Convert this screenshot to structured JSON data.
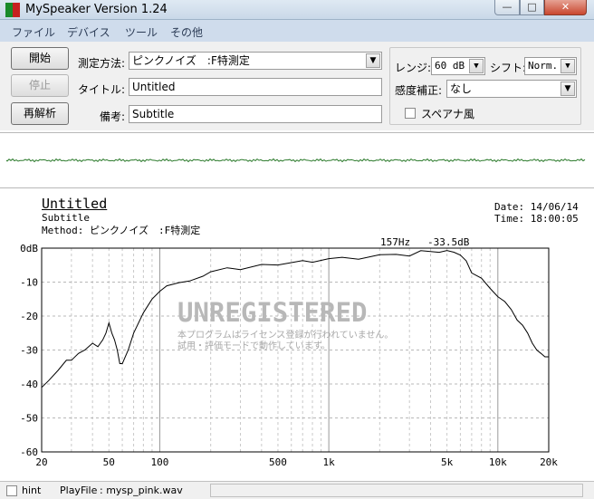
{
  "window": {
    "title": "MySpeaker Version 1.24",
    "min_glyph": "—",
    "max_glyph": "□",
    "close_glyph": "✕"
  },
  "menu": [
    "ファイル",
    "デバイス",
    "ツール",
    "その他"
  ],
  "buttons": {
    "start": "開始",
    "stop": "停止",
    "reanalyze": "再解析"
  },
  "fields": {
    "method_label": "測定方法:",
    "method_value": "ピンクノイズ　:F特測定",
    "title_label": "タイトル:",
    "title_value": "Untitled",
    "note_label": "備考:",
    "note_value": "Subtitle"
  },
  "right_panel": {
    "range_label": "レンジ:",
    "range_value": "60 dB",
    "shift_label": "シフト:",
    "shift_value": "Norm.",
    "sensitivity_label": "感度補正:",
    "sensitivity_value": "なし",
    "spectrum_label": "スペアナ風",
    "spectrum_checked": false
  },
  "graph_header": {
    "title": "Untitled",
    "subtitle": "Subtitle",
    "method": "Method:  ピンクノイズ　:F特測定",
    "date": "Date: 14/06/14",
    "time": "Time: 18:00:05",
    "peak_freq": "157Hz",
    "peak_level": "-33.5dB"
  },
  "watermark": {
    "title": "UNREGISTERED",
    "line1": "本プログラムはライセンス登録が行われていません。",
    "line2": "試用・評価モードで動作しています。"
  },
  "chart_data": {
    "type": "line",
    "xscale": "log",
    "xlim": [
      20,
      20000
    ],
    "ylim": [
      -60,
      0
    ],
    "y_ticks": [
      "0dB",
      "-10",
      "-20",
      "-30",
      "-40",
      "-50",
      "-60"
    ],
    "x_ticks": [
      "20",
      "50",
      "100",
      "500",
      "1k",
      "5k",
      "10k",
      "20k"
    ],
    "grid": true,
    "series": [
      {
        "x": [
          20,
          22,
          25,
          28,
          30,
          33,
          36,
          40,
          43,
          46,
          48,
          50,
          52,
          54,
          56,
          58,
          60,
          65,
          70,
          80,
          90,
          100,
          110,
          130,
          150,
          180,
          200,
          250,
          300,
          400,
          500,
          600,
          700,
          800,
          1000,
          1200,
          1500,
          2000,
          2500,
          3000,
          3500,
          4000,
          4500,
          5000,
          5500,
          6000,
          6500,
          7000,
          8000,
          9000,
          10000,
          11000,
          12000,
          13000,
          14000,
          15000,
          16000,
          17000,
          18000,
          19000,
          20000
        ],
        "values": [
          -41,
          -39,
          -36,
          -33,
          -33,
          -31,
          -30,
          -28,
          -29,
          -27,
          -25,
          -22,
          -25,
          -27,
          -30,
          -34,
          -34,
          -30,
          -25,
          -19,
          -15,
          -13,
          -11,
          -10,
          -10,
          -8,
          -7,
          -6,
          -6,
          -5,
          -5,
          -4,
          -4,
          -4,
          -3,
          -3,
          -3,
          -2,
          -2,
          -2,
          -1,
          -1,
          -1,
          -1,
          -1,
          -2,
          -4,
          -7,
          -9,
          -12,
          -14,
          -16,
          -18,
          -21,
          -23,
          -25,
          -28,
          -30,
          -31,
          -32,
          -32
        ]
      }
    ]
  },
  "status": {
    "hint_label": "hint",
    "playfile_label": "PlayFile",
    "playfile_value": ":  mysp_pink.wav"
  }
}
